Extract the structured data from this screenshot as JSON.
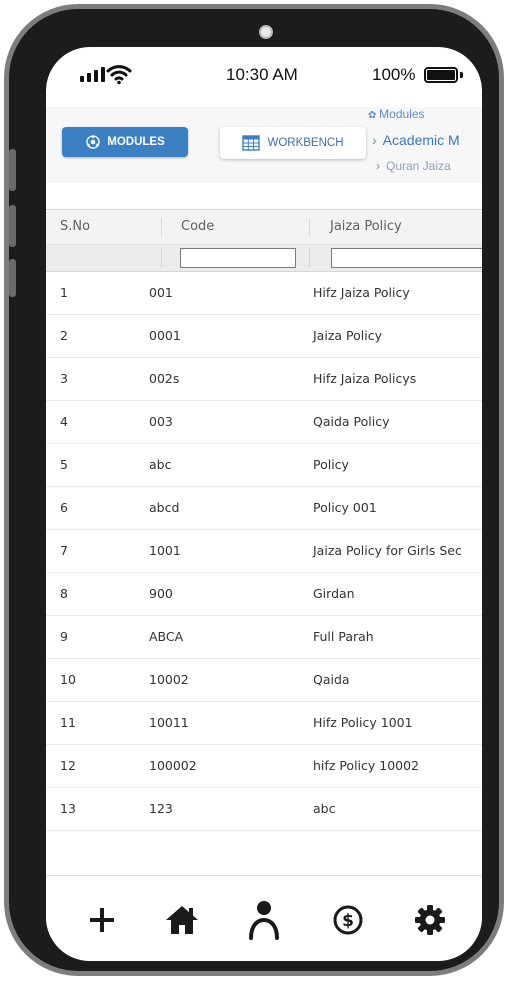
{
  "status_bar": {
    "time": "10:30 AM",
    "battery_percent": "100%",
    "battery_level": 1.0,
    "icons": [
      "signal-icon",
      "wifi-icon",
      "battery-icon"
    ]
  },
  "toolbar": {
    "modules_label": "MODULES",
    "workbench_label": "WORKBENCH",
    "modules_color": "#3a80c3",
    "icons": [
      "modules-icon",
      "workbench-icon"
    ]
  },
  "breadcrumb": {
    "top": "Modules",
    "current": "Academic M",
    "sub": "Quran Jaiza"
  },
  "table": {
    "columns": [
      "S.No",
      "Code",
      "Jaiza Policy"
    ],
    "rows": [
      {
        "sno": "1",
        "code": "001",
        "policy": "Hifz Jaiza Policy"
      },
      {
        "sno": "2",
        "code": "0001",
        "policy": "Jaiza Policy"
      },
      {
        "sno": "3",
        "code": "002s",
        "policy": "Hifz Jaiza Policys"
      },
      {
        "sno": "4",
        "code": "003",
        "policy": "Qaida Policy"
      },
      {
        "sno": "5",
        "code": "abc",
        "policy": "Policy"
      },
      {
        "sno": "6",
        "code": "abcd",
        "policy": "Policy 001"
      },
      {
        "sno": "7",
        "code": "1001",
        "policy": "Jaiza Policy for Girls Sec"
      },
      {
        "sno": "8",
        "code": "900",
        "policy": "Girdan"
      },
      {
        "sno": "9",
        "code": "ABCA",
        "policy": "Full Parah"
      },
      {
        "sno": "10",
        "code": "10002",
        "policy": "Qaida"
      },
      {
        "sno": "11",
        "code": "10011",
        "policy": "Hifz Policy 1001"
      },
      {
        "sno": "12",
        "code": "100002",
        "policy": "hifz Policy 10002"
      },
      {
        "sno": "13",
        "code": "123",
        "policy": "abc"
      }
    ]
  },
  "bottom_nav": {
    "items": [
      "add-icon",
      "home-icon",
      "profile-icon",
      "dollar-icon",
      "settings-icon"
    ]
  }
}
